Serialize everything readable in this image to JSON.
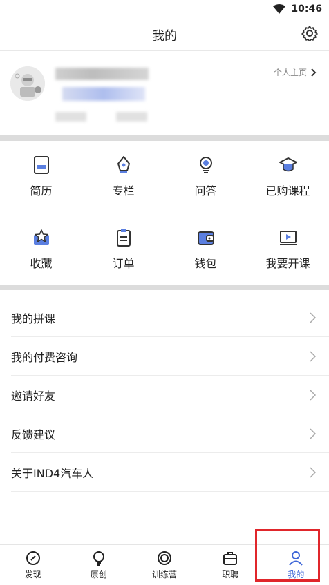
{
  "status_bar": {
    "time": "10:46"
  },
  "header": {
    "title": "我的"
  },
  "profile": {
    "homepage_link": "个人主页"
  },
  "grid": {
    "row1": [
      {
        "icon": "resume-icon",
        "label": "简历"
      },
      {
        "icon": "column-pen-icon",
        "label": "专栏"
      },
      {
        "icon": "qa-bulb-icon",
        "label": "问答"
      },
      {
        "icon": "graduation-cap-icon",
        "label": "已购课程"
      }
    ],
    "row2": [
      {
        "icon": "favorite-star-icon",
        "label": "收藏"
      },
      {
        "icon": "order-clipboard-icon",
        "label": "订单"
      },
      {
        "icon": "wallet-icon",
        "label": "钱包"
      },
      {
        "icon": "teach-course-icon",
        "label": "我要开课"
      }
    ]
  },
  "menu": [
    {
      "label": "我的拼课"
    },
    {
      "label": "我的付费咨询"
    },
    {
      "label": "邀请好友"
    },
    {
      "label": "反馈建议"
    },
    {
      "label": "关于IND4汽车人"
    }
  ],
  "tabbar": [
    {
      "icon": "discover-icon",
      "label": "发现",
      "active": false
    },
    {
      "icon": "original-bulb-icon",
      "label": "原创",
      "active": false
    },
    {
      "icon": "camp-target-icon",
      "label": "训练营",
      "active": false
    },
    {
      "icon": "briefcase-icon",
      "label": "职聘",
      "active": false
    },
    {
      "icon": "user-icon",
      "label": "我的",
      "active": true
    }
  ],
  "colors": {
    "accent": "#3f67d8",
    "highlight": "#e0262b"
  }
}
